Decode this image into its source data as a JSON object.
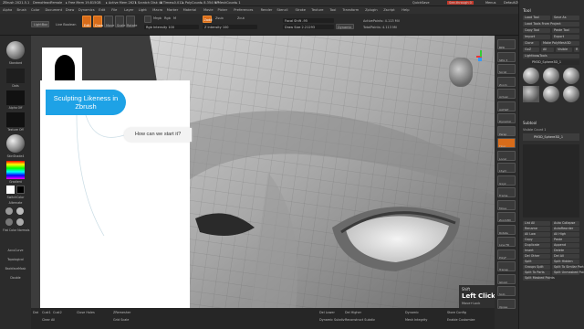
{
  "titlebar": {
    "app": "ZBrush 2021.5.1",
    "items": [
      "DemoHeadFemale",
      "▸ Free Mem 19.815GB",
      "▸ Active Mem 2627",
      "▸ Scratch Disk 45",
      "▸ Timer▸0.012",
      "▸ PolyCount▸ 8.354 MP",
      "▸ MeshCount▸ 1"
    ],
    "right": [
      "QuickSave",
      "See-through 0",
      "Menus",
      "DefaultZScript"
    ]
  },
  "menu": [
    "Alpha",
    "Brush",
    "Color",
    "Document",
    "Draw",
    "Dynamics",
    "Edit",
    "File",
    "Layer",
    "Light",
    "Macro",
    "Marker",
    "Material",
    "Movie",
    "Picker",
    "Preferences",
    "Render",
    "Stencil",
    "Stroke",
    "Texture",
    "Tool",
    "Transform",
    "Zplugin",
    "Zscript",
    "Help"
  ],
  "toolbar": {
    "tabs": [
      "LightBox",
      "Live Boolean"
    ],
    "modes": [
      "Edit",
      "Draw",
      "Move",
      "Scale",
      "Rotate"
    ],
    "mrgb": "Mrgb",
    "rgb": "Rgb",
    "m": "M",
    "zadd": "Zadd",
    "zsub": "Zsub",
    "zcut": "Zcut",
    "rgb_intensity": "Rgb Intensity 100",
    "z_intensity": "Z Intensity 100",
    "focal_shift": "Focal Shift -95",
    "draw_size": "Draw Size 2.21293",
    "dynamic": "Dynamic",
    "active_points": "ActivePoints: 4.113 Mil",
    "total_points": "TotalPoints: 4.113 Mil"
  },
  "coords": "-0.101,-0.546,-0.006",
  "leftshelf": {
    "labels": [
      "Standard",
      "Dots",
      "Alpha Off",
      "Texture Off",
      "SkinShade4",
      "Gradient",
      "SwitchColor",
      "Alternate",
      "Flat Color Normals",
      "AccuCurve",
      "Topological",
      "BackfaceMask",
      "Double"
    ]
  },
  "rightshelf": [
    "BPR",
    "SPix 3",
    "Scroll",
    "Zoom",
    "Actual",
    "AAHalf",
    "Dynamic",
    "Persp",
    "Floor",
    "Local",
    "LSym",
    "Gxyz",
    "Frame",
    "Move",
    "Zoom3D",
    "Rotate",
    "Line Fill",
    "PolyF",
    "Transp",
    "Ghost",
    "Solo",
    "Xpose"
  ],
  "toolpanel": {
    "title": "Tool",
    "buttons": [
      "Load Tool",
      "Save As",
      "Load Tools From Project",
      "Copy Tool",
      "Paste Tool",
      "Import",
      "Export",
      "Clone",
      "Make PolyMesh3D",
      "GoZ",
      "All",
      "Visible",
      "R",
      "Lightbox▸Tools",
      "PM3D_Sphere3D_1"
    ],
    "subtool": "Subtool",
    "visible_count": "Visible Count 1",
    "subtool_name": "PM3D_Sphere3D_1",
    "more": [
      "List All",
      "Auto Collapse",
      "Rename",
      "AutoReorder",
      "All Low",
      "All High",
      "Copy",
      "Paste",
      "Duplicate",
      "Append",
      "Insert",
      "Delete",
      "Del Other",
      "Del All",
      "Split",
      "Split Hidden",
      "Groups Split",
      "Split To Similar Parts",
      "Split To Parts",
      "Split Unmasked Points",
      "Split Masked Points"
    ]
  },
  "bottombar": {
    "items": [
      "Dot",
      "Cust1",
      "Cust2",
      "Clear All",
      "Close Holes",
      "ZRemesher",
      "Grid Scale",
      "Dynamic",
      "Mesh Integrity",
      "Store Config",
      "Enable Customize",
      "Del Lower",
      "Del Higher",
      "Reconstruct Subdiv",
      "Dynamic Subdiv"
    ]
  },
  "overlay": {
    "title": "Sculpting Likeness in Zbrush",
    "question": "How can we start it?"
  },
  "clickhint": {
    "shift": "Shift",
    "left_click": "Left Click",
    "drag": "Move+Lock"
  }
}
